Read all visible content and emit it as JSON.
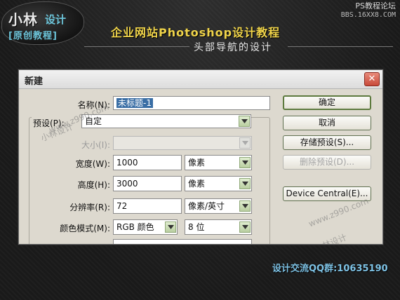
{
  "header": {
    "logo_main": "小林",
    "logo_sub": "设计",
    "logo_tag": "[原创教程]",
    "site_name": "PS教程论坛",
    "site_url": "BBS.16XX8.COM",
    "title": "企业网站Photoshop设计教程",
    "subtitle": "头部导航的设计"
  },
  "dialog": {
    "title": "新建",
    "name_label": "名称(N):",
    "name_value": "未标题-1",
    "preset_label": "预设(P):",
    "preset_value": "自定",
    "size_label": "大小(I):",
    "width_label": "宽度(W):",
    "width_value": "1000",
    "width_unit": "像素",
    "height_label": "高度(H):",
    "height_value": "3000",
    "height_unit": "像素",
    "resolution_label": "分辨率(R):",
    "resolution_value": "72",
    "resolution_unit": "像素/英寸",
    "color_mode_label": "颜色模式(M):",
    "color_mode_value": "RGB 颜色",
    "bit_depth_value": "8 位",
    "buttons": {
      "ok": "确定",
      "cancel": "取消",
      "save_preset": "存储预设(S)...",
      "delete_preset": "删除预设(D)...",
      "device_central": "Device Central(E)..."
    }
  },
  "watermarks": {
    "url1": "www.z990.com",
    "brand1": "小林设计",
    "url2": "www.z990.com",
    "brand2": "小林设计"
  },
  "footer": {
    "qq_group": "设计交流QQ群:10635190"
  },
  "colors": {
    "title_yellow": "#f0d44a",
    "accent_cyan": "#6bc3d8",
    "dialog_bg": "#ddd9cf",
    "combo_green": "#b9cea0"
  }
}
